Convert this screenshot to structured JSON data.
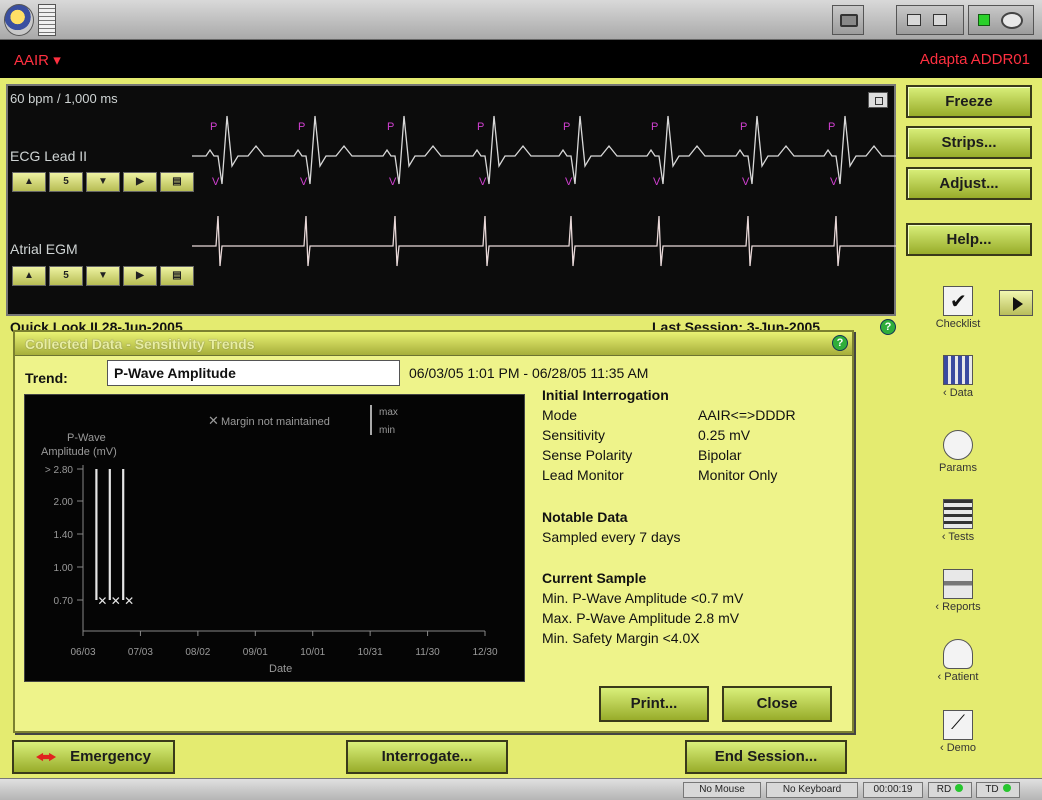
{
  "mode_bar": {
    "mode": "AAIR",
    "device": "Adapta ADDR01"
  },
  "ecg": {
    "rate": "60 bpm / 1,000 ms",
    "ecg_label": "ECG Lead II",
    "egm_label": "Atrial EGM",
    "size_value": "5"
  },
  "right_buttons": {
    "freeze": "Freeze",
    "strips": "Strips...",
    "adjust": "Adjust...",
    "help": "Help..."
  },
  "nav": [
    {
      "label": "Checklist",
      "icon": "checklist-icon"
    },
    {
      "label": "‹ Data",
      "icon": "data-chart-icon"
    },
    {
      "label": "Params",
      "icon": "params-icon"
    },
    {
      "label": "‹ Tests",
      "icon": "tests-icon"
    },
    {
      "label": "‹ Reports",
      "icon": "reports-icon"
    },
    {
      "label": "‹ Patient",
      "icon": "patient-icon"
    },
    {
      "label": "‹ Demo",
      "icon": "demo-icon"
    }
  ],
  "under_panel": {
    "left": "Quick Look II  28-Jun-2005",
    "right": "Last Session: 3-Jun-2005"
  },
  "dialog": {
    "title": "Collected Data - Sensitivity Trends",
    "trend_label": "Trend:",
    "trend_value": "P-Wave Amplitude",
    "date_range": "06/03/05 1:01 PM - 06/28/05 11:35 AM",
    "initial_title": "Initial Interrogation",
    "rows": [
      {
        "label": "Mode",
        "value": "AAIR<=>DDDR"
      },
      {
        "label": "Sensitivity",
        "value": "0.25 mV"
      },
      {
        "label": "Sense Polarity",
        "value": "Bipolar"
      },
      {
        "label": "Lead Monitor",
        "value": "Monitor Only"
      }
    ],
    "notable_title": "Notable Data",
    "notable_value": "Sampled every 7 days",
    "current_title": "Current Sample",
    "current_lines": [
      "Min. P-Wave Amplitude <0.7 mV",
      "Max. P-Wave Amplitude 2.8 mV",
      "Min. Safety Margin <4.0X"
    ],
    "print": "Print...",
    "close": "Close"
  },
  "bottom": {
    "emergency": "Emergency",
    "interrogate": "Interrogate...",
    "end_session": "End Session..."
  },
  "status": {
    "mouse": "No Mouse",
    "keyboard": "No Keyboard",
    "timer": "00:00:19",
    "rd": "RD",
    "td": "TD"
  },
  "chart_data": {
    "type": "scatter",
    "ylabel": "P-Wave Amplitude (mV)",
    "xlabel": "Date",
    "legend": {
      "marker": "Margin not maintained",
      "bar_max": "max",
      "bar_min": "min"
    },
    "y_ticks": [
      "> 2.80",
      "2.00",
      "1.40",
      "1.00",
      "0.70"
    ],
    "x_ticks": [
      "06/03",
      "07/03",
      "08/02",
      "09/01",
      "10/01",
      "10/31",
      "11/30",
      "12/30"
    ],
    "series": [
      {
        "x": "06/10",
        "min": 0.7,
        "max": 2.8,
        "margin_not_maintained": true
      },
      {
        "x": "06/17",
        "min": 0.7,
        "max": 2.8,
        "margin_not_maintained": true
      },
      {
        "x": "06/24",
        "min": 0.7,
        "max": 2.8,
        "margin_not_maintained": true
      }
    ]
  }
}
